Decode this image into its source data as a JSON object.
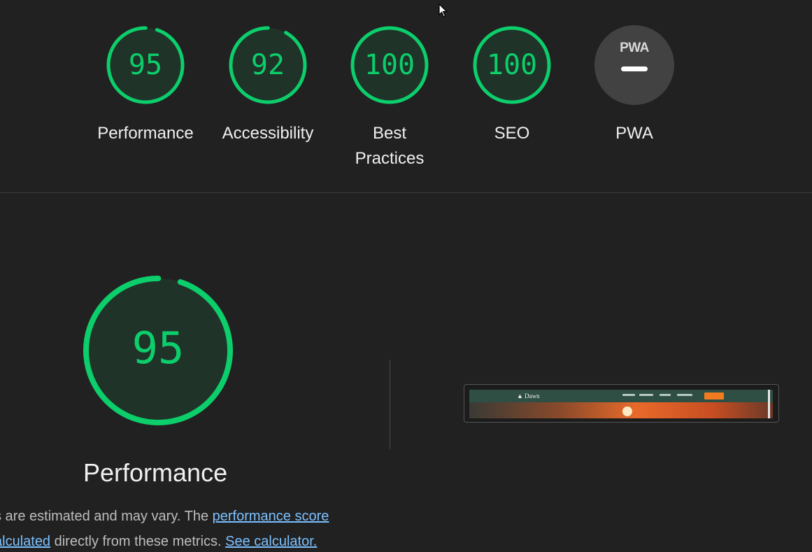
{
  "summary": {
    "gauges": [
      {
        "label": "Performance",
        "score": "95",
        "value": 95
      },
      {
        "label": "Accessibility",
        "score": "92",
        "value": 92
      },
      {
        "label": "Best Practices",
        "score": "100",
        "value": 100
      },
      {
        "label": "SEO",
        "score": "100",
        "value": 100
      },
      {
        "label": "PWA",
        "badge": "PWA"
      }
    ]
  },
  "performance": {
    "score": "95",
    "value": 95,
    "title": "Performance",
    "line1_text": "s are estimated and may vary. The ",
    "line1_link": "performance score",
    "line2_link1": "alculated",
    "line2_text": " directly from these metrics. ",
    "line2_link2": "See calculator."
  },
  "screenshot": {
    "site_name": "Dawn"
  },
  "colors": {
    "pass": "#0cce6b",
    "pass_bg": "#1f3328",
    "pwa_bg": "#424242",
    "background": "#212121",
    "link": "#7cc0ff",
    "cta": "#f07c1f"
  },
  "icons": {
    "cursor": "mouse-pointer-icon"
  }
}
